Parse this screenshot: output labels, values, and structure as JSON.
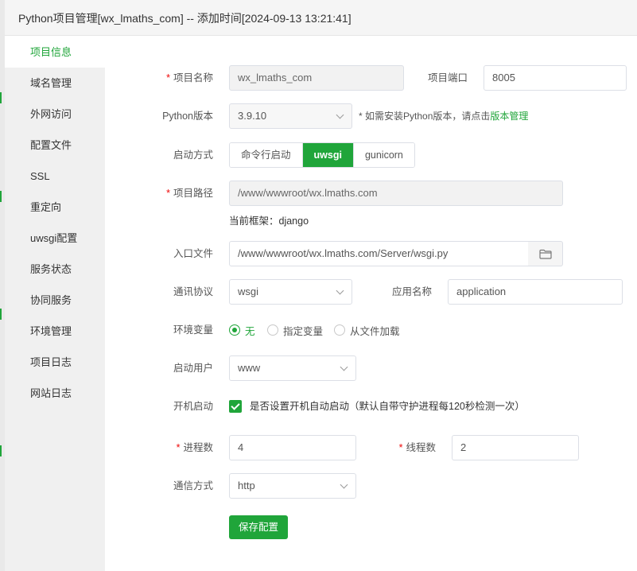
{
  "title": "Python项目管理[wx_lmaths_com] -- 添加时间[2024-09-13 13:21:41]",
  "sidebar": {
    "items": [
      {
        "label": "项目信息"
      },
      {
        "label": "域名管理"
      },
      {
        "label": "外网访问"
      },
      {
        "label": "配置文件"
      },
      {
        "label": "SSL"
      },
      {
        "label": "重定向"
      },
      {
        "label": "uwsgi配置"
      },
      {
        "label": "服务状态"
      },
      {
        "label": "协同服务"
      },
      {
        "label": "环境管理"
      },
      {
        "label": "项目日志"
      },
      {
        "label": "网站日志"
      }
    ]
  },
  "form": {
    "name": {
      "label": "项目名称",
      "value": "wx_lmaths_com"
    },
    "port": {
      "label": "项目端口",
      "value": "8005"
    },
    "python_version": {
      "label": "Python版本",
      "value": "3.9.10",
      "tip": "* 如需安装Python版本，请点击",
      "tip_link": "版本管理"
    },
    "startup": {
      "label": "启动方式",
      "options": [
        "命令行启动",
        "uwsgi",
        "gunicorn"
      ],
      "selected": "uwsgi"
    },
    "path": {
      "label": "项目路径",
      "value": "/www/wwwroot/wx.lmaths.com"
    },
    "framework": "当前框架：django",
    "entry": {
      "label": "入口文件",
      "value": "/www/wwwroot/wx.lmaths.com/Server/wsgi.py"
    },
    "protocol": {
      "label": "通讯协议",
      "value": "wsgi"
    },
    "app_name": {
      "label": "应用名称",
      "value": "application"
    },
    "env": {
      "label": "环境变量",
      "options": [
        "无",
        "指定变量",
        "从文件加载"
      ],
      "selected": "无"
    },
    "user": {
      "label": "启动用户",
      "value": "www"
    },
    "autostart": {
      "label": "开机启动",
      "checked": true,
      "text": "是否设置开机自动启动（默认自带守护进程每120秒检测一次）"
    },
    "processes": {
      "label": "进程数",
      "value": "4"
    },
    "threads": {
      "label": "线程数",
      "value": "2"
    },
    "comm": {
      "label": "通信方式",
      "value": "http"
    },
    "required_mark": "*",
    "save_label": "保存配置"
  },
  "colors": {
    "accent": "#20a53a",
    "required": "#ef0808"
  }
}
